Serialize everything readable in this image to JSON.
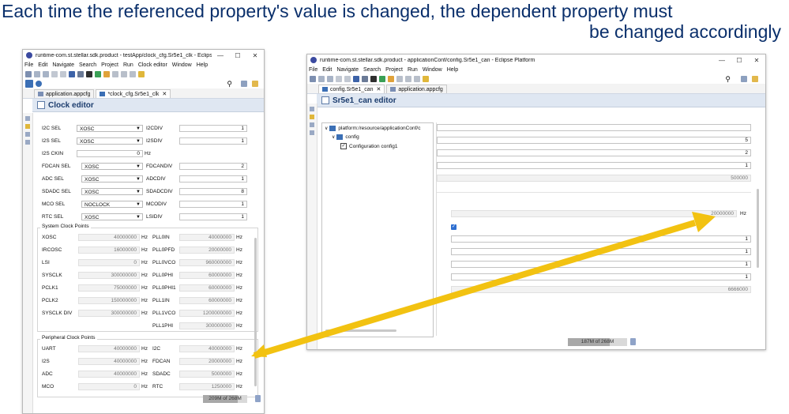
{
  "headline": {
    "line1": "Each time the referenced property's value is changed, the dependent property must",
    "line2": "be changed accordingly"
  },
  "colors": {
    "headline": "#0a2f6b",
    "arrow": "#f2c211",
    "accent": "#1c3d6e"
  },
  "left_window": {
    "title": "runtime-com.st.stellar.sdk.product - testApp/clock_cfg.Sr5e1_clk - Eclipse P...",
    "menu": [
      "File",
      "Edit",
      "Navigate",
      "Search",
      "Project",
      "Run",
      "Clock editor",
      "Window",
      "Help"
    ],
    "tabs": [
      {
        "label": "application.appcfg",
        "active": false
      },
      {
        "label": "*clock_cfg.Sr5e1_clk",
        "active": true,
        "close": "✕"
      }
    ],
    "editor_title": "Clock editor",
    "selectors_left": [
      {
        "label": "I2C SEL",
        "value": "XOSC"
      },
      {
        "label": "I2S SEL",
        "value": "XOSC"
      },
      {
        "label": "I2S CKIN",
        "value": "0",
        "unit": "Hz"
      },
      {
        "label": "FDCAN SEL",
        "value": "XOSC"
      },
      {
        "label": "ADC SEL",
        "value": "XOSC"
      },
      {
        "label": "SDADC SEL",
        "value": "XOSC"
      },
      {
        "label": "MCO SEL",
        "value": "NOCLOCK"
      },
      {
        "label": "RTC SEL",
        "value": "XOSC"
      }
    ],
    "dividers_right": [
      {
        "label": "I2CDIV",
        "value": "1"
      },
      {
        "label": "I2SDIV",
        "value": "1"
      },
      {
        "label": "FDCANDIV",
        "value": "2"
      },
      {
        "label": "ADCDIV",
        "value": "1"
      },
      {
        "label": "SDADCDIV",
        "value": "8"
      },
      {
        "label": "MCODIV",
        "value": "1"
      },
      {
        "label": "LSIDIV",
        "value": "1"
      }
    ],
    "system_clock_title": "System Clock Points",
    "system_left": [
      {
        "label": "XOSC",
        "value": "40000000",
        "unit": "Hz"
      },
      {
        "label": "IRCOSC",
        "value": "16000000",
        "unit": "Hz"
      },
      {
        "label": "LSI",
        "value": "0",
        "unit": "Hz"
      },
      {
        "label": "SYSCLK",
        "value": "300000000",
        "unit": "Hz"
      },
      {
        "label": "PCLK1",
        "value": "75000000",
        "unit": "Hz"
      },
      {
        "label": "PCLK2",
        "value": "150000000",
        "unit": "Hz"
      },
      {
        "label": "SYSCLK DIV",
        "value": "300000000",
        "unit": "Hz"
      }
    ],
    "system_right": [
      {
        "label": "PLL0IN",
        "value": "40000000",
        "unit": "Hz"
      },
      {
        "label": "PLL0PFD",
        "value": "20000000",
        "unit": "Hz"
      },
      {
        "label": "PLL0VCO",
        "value": "960000000",
        "unit": "Hz"
      },
      {
        "label": "PLL0PHI",
        "value": "60000000",
        "unit": "Hz"
      },
      {
        "label": "PLL0PHI1",
        "value": "60000000",
        "unit": "Hz"
      },
      {
        "label": "PLL1IN",
        "value": "60000000",
        "unit": "Hz"
      },
      {
        "label": "PLL1VCO",
        "value": "1200000000",
        "unit": "Hz"
      },
      {
        "label": "PLL1PHI",
        "value": "300000000",
        "unit": "Hz"
      }
    ],
    "peripheral_title": "Peripheral Clock Points",
    "peripheral_left": [
      {
        "label": "UART",
        "value": "40000000",
        "unit": "Hz"
      },
      {
        "label": "I2S",
        "value": "40000000",
        "unit": "Hz"
      },
      {
        "label": "ADC",
        "value": "40000000",
        "unit": "Hz"
      },
      {
        "label": "MCO",
        "value": "0",
        "unit": "Hz"
      }
    ],
    "peripheral_right": [
      {
        "label": "I2C",
        "value": "40000000",
        "unit": "Hz"
      },
      {
        "label": "FDCAN",
        "value": "20000000",
        "unit": "Hz"
      },
      {
        "label": "SDADC",
        "value": "5000000",
        "unit": "Hz"
      },
      {
        "label": "RTC",
        "value": "1250000",
        "unit": "Hz"
      }
    ],
    "heap_status": "209M of 268M",
    "heap_fraction": 0.78
  },
  "right_window": {
    "title": "runtime-com.st.stellar.sdk.product - applicationConf/config.Sr5e1_can - Eclipse Platform",
    "menu": [
      "File",
      "Edit",
      "Navigate",
      "Search",
      "Project",
      "Run",
      "Window",
      "Help"
    ],
    "tabs": [
      {
        "label": "config.Sr5e1_can",
        "active": true,
        "close": "✕"
      },
      {
        "label": "application.appcfg",
        "active": false
      }
    ],
    "editor_title": "Sr5e1_can editor",
    "tree": [
      {
        "label": "platform:/resource/applicationConf/c",
        "level": 0
      },
      {
        "label": "config",
        "level": 1
      },
      {
        "label": "Configuration config1",
        "level": 2,
        "checked": true
      }
    ],
    "fields_top": [
      "",
      "5",
      "2",
      "1",
      "500000"
    ],
    "field_hz": {
      "value": "20000000",
      "unit": "Hz"
    },
    "fields_bottom": [
      "1",
      "1",
      "1",
      "1",
      "6666000"
    ],
    "heap_status": "187M of 268M",
    "heap_fraction": 0.7
  }
}
